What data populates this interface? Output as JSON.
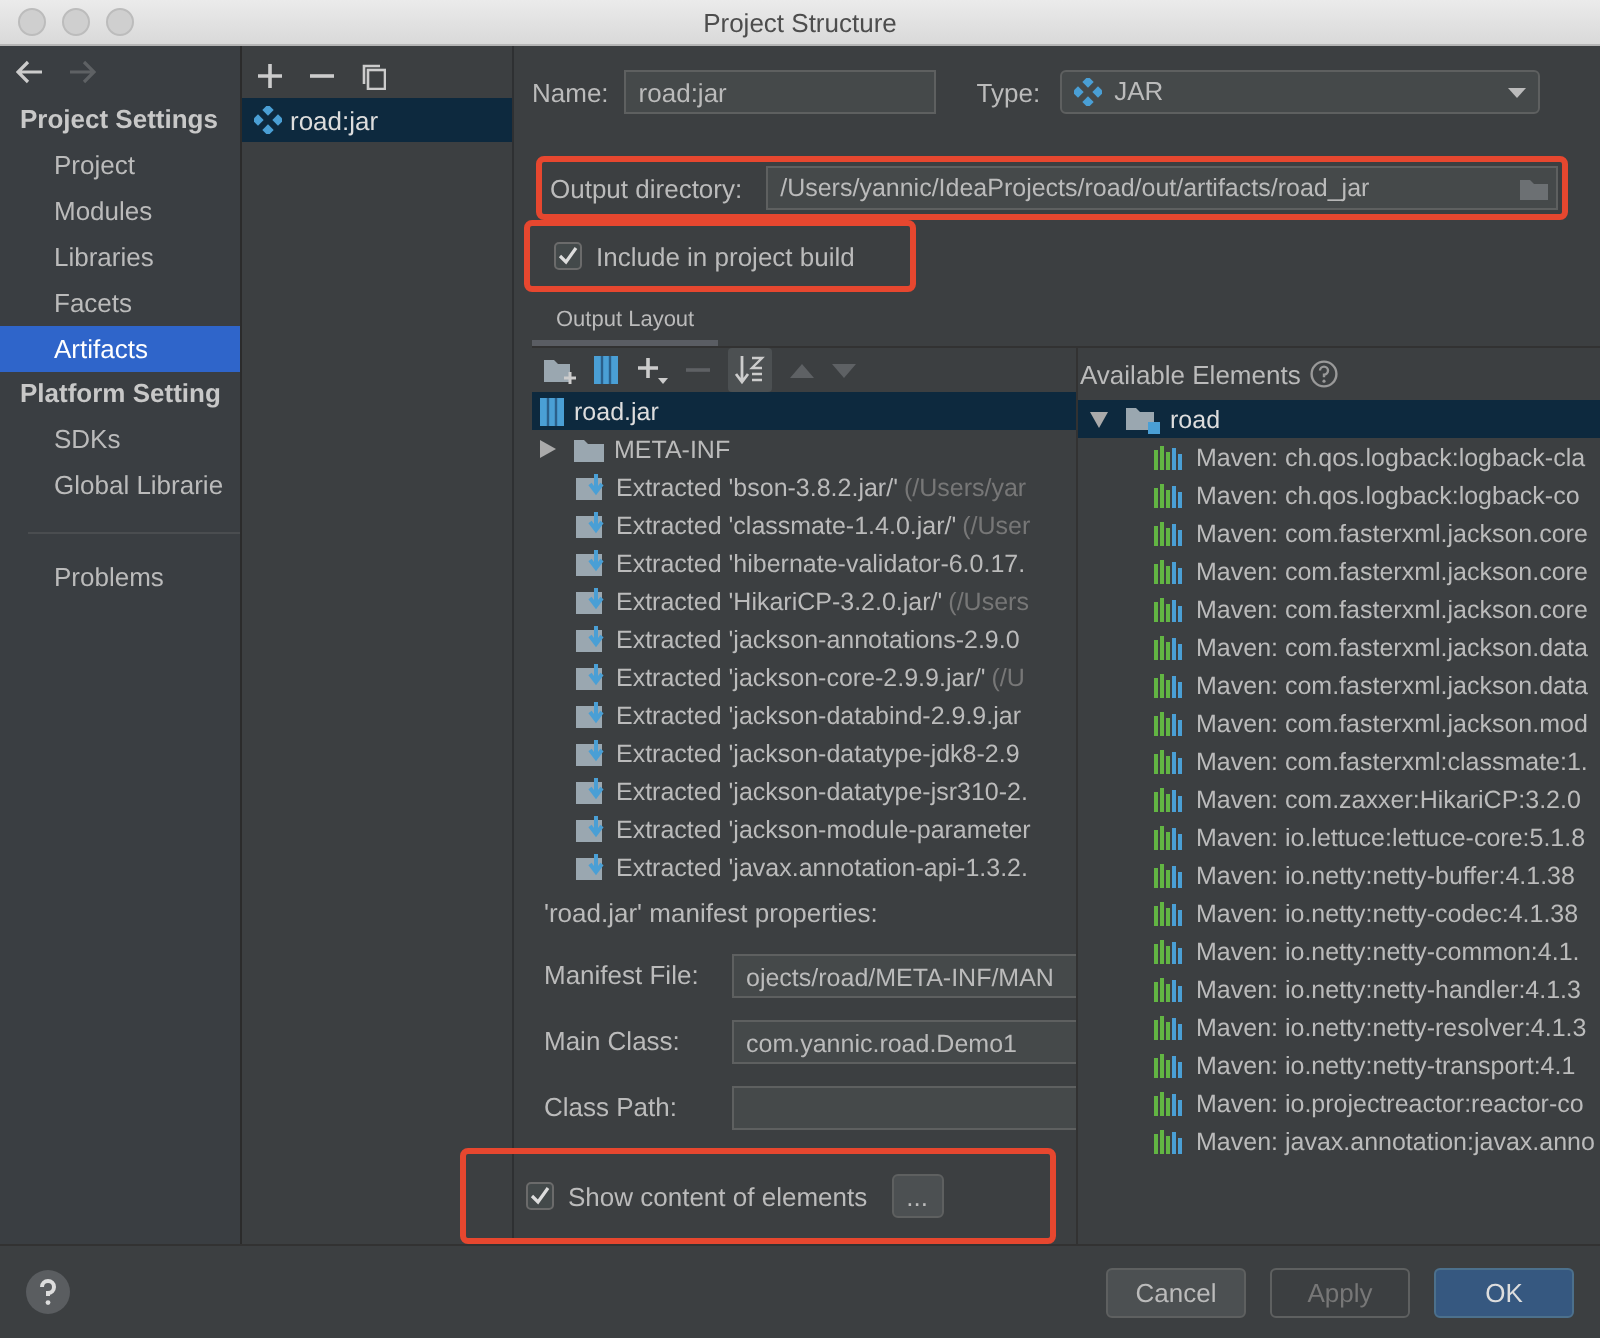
{
  "window": {
    "title": "Project Structure"
  },
  "sidebar": {
    "sections": [
      {
        "title": "Project Settings",
        "items": [
          {
            "label": "Project",
            "selected": false
          },
          {
            "label": "Modules",
            "selected": false
          },
          {
            "label": "Libraries",
            "selected": false
          },
          {
            "label": "Facets",
            "selected": false
          },
          {
            "label": "Artifacts",
            "selected": true
          }
        ]
      },
      {
        "title": "Platform Setting",
        "items": [
          {
            "label": "SDKs",
            "selected": false
          },
          {
            "label": "Global Librarie",
            "selected": false
          }
        ]
      }
    ],
    "problems": {
      "label": "Problems",
      "selected": false
    }
  },
  "artifacts_list": {
    "items": [
      {
        "label": "road:jar",
        "selected": true
      }
    ]
  },
  "form": {
    "name": {
      "label": "Name:",
      "value": "road:jar"
    },
    "type": {
      "label": "Type:",
      "value": "JAR"
    },
    "output_directory": {
      "label": "Output directory:",
      "value": "/Users/yannic/IdeaProjects/road/out/artifacts/road_jar",
      "highlighted": true
    },
    "include_in_build": {
      "label": "Include in project build",
      "checked": true,
      "highlighted": true
    }
  },
  "layout_tabs": [
    {
      "label": "Output Layout",
      "selected": true
    }
  ],
  "output_tree": {
    "root": {
      "label": "road.jar",
      "selected": true
    },
    "children": [
      {
        "kind": "folder",
        "label": "META-INF",
        "expanded": false
      },
      {
        "kind": "extracted",
        "label": "Extracted 'bson-3.8.2.jar/'",
        "detail": "(/Users/yar"
      },
      {
        "kind": "extracted",
        "label": "Extracted 'classmate-1.4.0.jar/'",
        "detail": "(/User"
      },
      {
        "kind": "extracted",
        "label": "Extracted 'hibernate-validator-6.0.17."
      },
      {
        "kind": "extracted",
        "label": "Extracted 'HikariCP-3.2.0.jar/'",
        "detail": "(/Users"
      },
      {
        "kind": "extracted",
        "label": "Extracted 'jackson-annotations-2.9.0"
      },
      {
        "kind": "extracted",
        "label": "Extracted 'jackson-core-2.9.9.jar/'",
        "detail": "(/U"
      },
      {
        "kind": "extracted",
        "label": "Extracted 'jackson-databind-2.9.9.jar"
      },
      {
        "kind": "extracted",
        "label": "Extracted 'jackson-datatype-jdk8-2.9"
      },
      {
        "kind": "extracted",
        "label": "Extracted 'jackson-datatype-jsr310-2."
      },
      {
        "kind": "extracted",
        "label": "Extracted 'jackson-module-parameter"
      },
      {
        "kind": "extracted",
        "label": "Extracted 'javax.annotation-api-1.3.2."
      }
    ]
  },
  "available": {
    "title": "Available Elements",
    "root": {
      "label": "road",
      "expanded": true,
      "selected": true
    },
    "children": [
      {
        "label": "Maven: ch.qos.logback:logback-cla"
      },
      {
        "label": "Maven: ch.qos.logback:logback-co"
      },
      {
        "label": "Maven: com.fasterxml.jackson.core"
      },
      {
        "label": "Maven: com.fasterxml.jackson.core"
      },
      {
        "label": "Maven: com.fasterxml.jackson.core"
      },
      {
        "label": "Maven: com.fasterxml.jackson.data"
      },
      {
        "label": "Maven: com.fasterxml.jackson.data"
      },
      {
        "label": "Maven: com.fasterxml.jackson.mod"
      },
      {
        "label": "Maven: com.fasterxml:classmate:1."
      },
      {
        "label": "Maven: com.zaxxer:HikariCP:3.2.0"
      },
      {
        "label": "Maven: io.lettuce:lettuce-core:5.1.8"
      },
      {
        "label": "Maven: io.netty:netty-buffer:4.1.38"
      },
      {
        "label": "Maven: io.netty:netty-codec:4.1.38"
      },
      {
        "label": "Maven: io.netty:netty-common:4.1."
      },
      {
        "label": "Maven: io.netty:netty-handler:4.1.3"
      },
      {
        "label": "Maven: io.netty:netty-resolver:4.1.3"
      },
      {
        "label": "Maven: io.netty:netty-transport:4.1"
      },
      {
        "label": "Maven: io.projectreactor:reactor-co"
      },
      {
        "label": "Maven: javax.annotation:javax.anno"
      }
    ]
  },
  "manifest": {
    "title": "'road.jar' manifest properties:",
    "fields": [
      {
        "label": "Manifest File:",
        "value": "ojects/road/META-INF/MAN"
      },
      {
        "label": "Main Class:",
        "value": "com.yannic.road.Demo1"
      },
      {
        "label": "Class Path:"
      }
    ]
  },
  "show_content": {
    "label": "Show content of elements",
    "checked": true,
    "highlighted": true,
    "button": "..."
  },
  "buttons": [
    {
      "label": "Cancel",
      "kind": "default"
    },
    {
      "label": "Apply",
      "kind": "disabled"
    },
    {
      "label": "OK",
      "kind": "primary"
    }
  ]
}
